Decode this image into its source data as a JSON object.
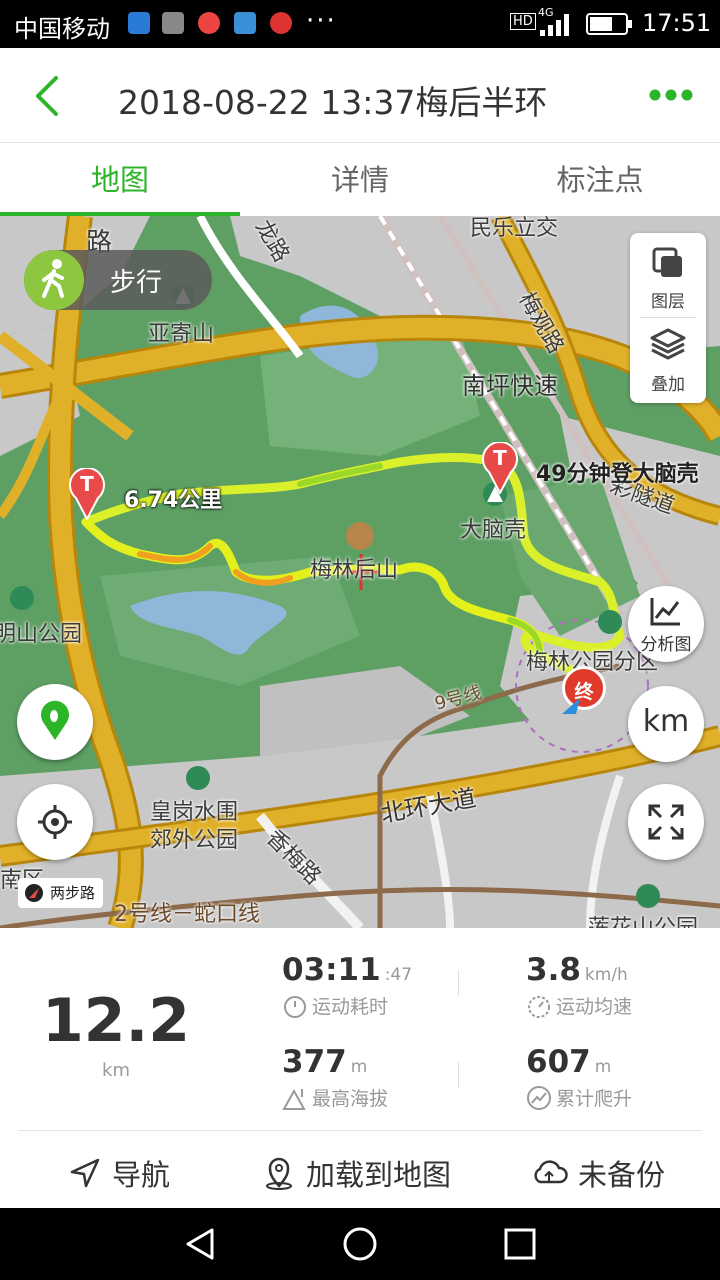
{
  "status_bar": {
    "carrier": "中国移动",
    "more": "···",
    "hd": "HD",
    "network": "4G",
    "time": "17:51"
  },
  "header": {
    "title": "2018-08-22 13:37梅后半环"
  },
  "tabs": [
    {
      "label": "地图",
      "active": true
    },
    {
      "label": "详情",
      "active": false
    },
    {
      "label": "标注点",
      "active": false
    }
  ],
  "map": {
    "mode_label": "步行",
    "layer_label": "图层",
    "overlay_label": "叠加",
    "analysis_label": "分析图",
    "unit_toggle": "km",
    "route_distance": "6.74公里",
    "route_note": "49分钟登大脑壳",
    "end_marker": "终",
    "start_marker": "T",
    "waypoint_marker": "T",
    "street_chip": "两步路",
    "labels": {
      "road_top_left": "路",
      "yajishan": "亚寄山",
      "pingkuaisu": "南坪快速",
      "meiguanlu": "梅观路",
      "minle": "民乐立交",
      "dananke": "大脑壳",
      "meilinhoushan": "梅林后山",
      "caituidao": "彩隧道",
      "mingshan": "明山公园",
      "meilinpark": "梅林公园分区",
      "line9": "9号线",
      "beihuan": "北环大道",
      "huanggang": "皇岗水围",
      "huanggang2": "郊外公园",
      "xiangmei": "香梅路",
      "line2": "2号线－蛇口线",
      "nanqu": "南区",
      "lianhua": "莲花山公园",
      "longlu": "龙路"
    }
  },
  "stats": {
    "distance": "12.2",
    "distance_unit": "km",
    "duration": "03:11",
    "duration_sec": ":47",
    "duration_label": "运动耗时",
    "avg_speed": "3.8",
    "avg_speed_unit": "km/h",
    "avg_speed_label": "运动均速",
    "max_alt": "377",
    "max_alt_unit": "m",
    "max_alt_label": "最高海拔",
    "climb": "607",
    "climb_unit": "m",
    "climb_label": "累计爬升"
  },
  "actions": {
    "navigate": "导航",
    "load_to_map": "加载到地图",
    "backup": "未备份"
  },
  "colors": {
    "accent": "#2db52a",
    "map_green": "#5e9f64",
    "road_yellow": "#d8a520",
    "route_yellow": "#e6f21a"
  }
}
